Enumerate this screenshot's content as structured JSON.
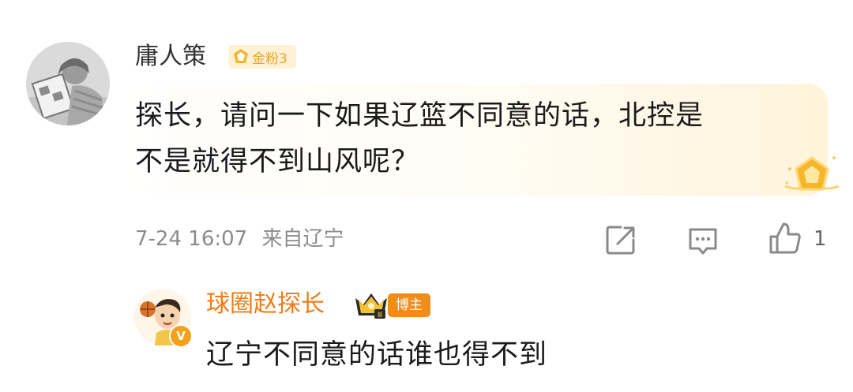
{
  "comment": {
    "username": "庸人策",
    "fan_badge": "金粉3",
    "text_line1": "探长，请问一下如果辽篮不同意的话，北控是",
    "text_line2": "不是就得不到山风呢？",
    "timestamp": "7-24 16:07",
    "location": "来自辽宁",
    "like_count": "1",
    "icons": {
      "share": "share-icon",
      "comment": "comment-icon",
      "like": "thumbs-up-icon"
    }
  },
  "reply": {
    "username": "球圈赵探长",
    "host_badge": "博主",
    "verified_mark": "V",
    "text": "辽宁不同意的话谁也得不到"
  },
  "colors": {
    "accent_orange": "#ee7d18",
    "badge_gold": "#e8a32c",
    "meta_gray": "#8c8c8c"
  }
}
